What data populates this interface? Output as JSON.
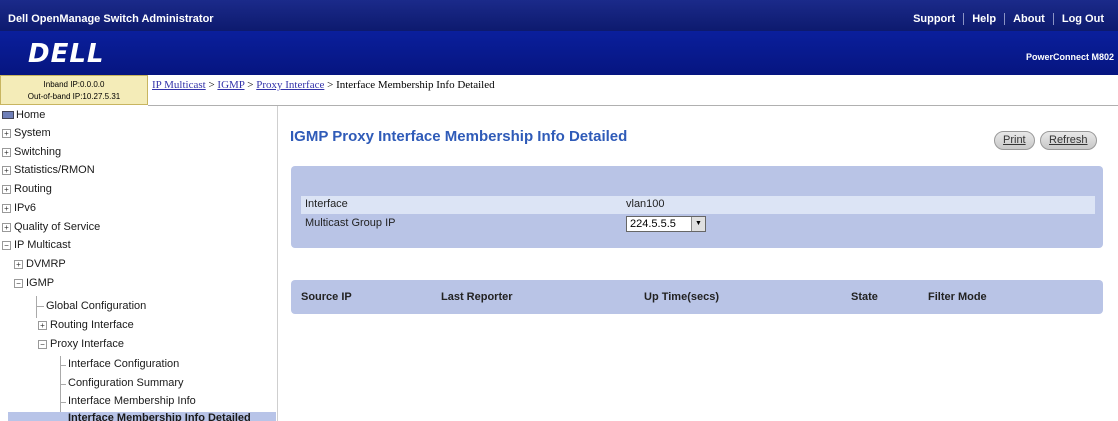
{
  "topbar": {
    "app_title": "Dell OpenManage Switch Administrator",
    "links": [
      "Support",
      "Help",
      "About",
      "Log Out"
    ]
  },
  "logobar": {
    "logo": "DELL",
    "product": "PowerConnect M802"
  },
  "ipinfo": {
    "inband": "Inband IP:0.0.0.0",
    "outband": "Out-of-band IP:10.27.5.31"
  },
  "breadcrumb": {
    "items": [
      "IP Multicast",
      "IGMP",
      "Proxy Interface"
    ],
    "current": "Interface Membership Info Detailed",
    "sep": " > "
  },
  "sidebar": {
    "items": [
      {
        "label": "Home"
      },
      {
        "label": "System",
        "expander": "+"
      },
      {
        "label": "Switching",
        "expander": "+"
      },
      {
        "label": "Statistics/RMON",
        "expander": "+"
      },
      {
        "label": "Routing",
        "expander": "+"
      },
      {
        "label": "IPv6",
        "expander": "+"
      },
      {
        "label": "Quality of Service",
        "expander": "+"
      },
      {
        "label": "IP Multicast",
        "expander": "−"
      },
      {
        "label": "DVMRP",
        "expander": "+"
      },
      {
        "label": "IGMP",
        "expander": "−"
      },
      {
        "label": "Global Configuration"
      },
      {
        "label": "Routing Interface",
        "expander": "+"
      },
      {
        "label": "Proxy Interface",
        "expander": "−"
      },
      {
        "label": "Interface Configuration"
      },
      {
        "label": "Configuration Summary"
      },
      {
        "label": "Interface Membership Info"
      },
      {
        "label": "Interface Membership Info Detailed"
      }
    ]
  },
  "main": {
    "title": "IGMP Proxy Interface Membership Info Detailed",
    "print_label": "Print",
    "refresh_label": "Refresh",
    "form": {
      "interface_label": "Interface",
      "interface_value": "vlan100",
      "group_label": "Multicast Group IP",
      "group_value": "224.5.5.5"
    },
    "table_headers": [
      "Source IP",
      "Last Reporter",
      "Up Time(secs)",
      "State",
      "Filter Mode"
    ]
  },
  "colors": {
    "header_bg": "#0d1a6e",
    "panel_bg": "#b9c4e6",
    "title": "#2f5bb8",
    "selected": "#b8c4e8"
  }
}
